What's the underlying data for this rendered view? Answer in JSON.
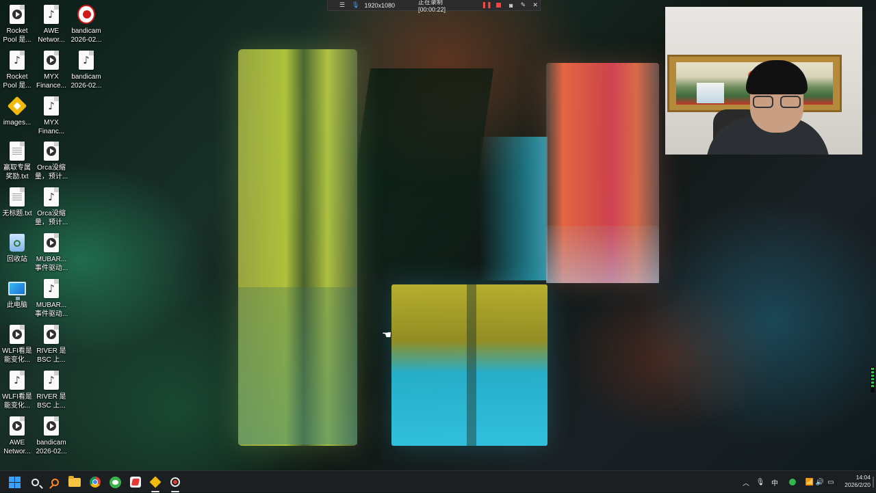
{
  "recorder_bar": {
    "resolution": "1920x1080",
    "status": "正在录制 [00:00:22]"
  },
  "desktop_icons": [
    {
      "label": "Rocket\nPool 是...",
      "icon": "video-file-icon"
    },
    {
      "label": "AWE\nNetwor...",
      "icon": "audio-file-icon"
    },
    {
      "label": "bandicam\n2026-02...",
      "icon": "bandicam-icon"
    },
    {
      "label": "Rocket\nPool 是...",
      "icon": "audio-file-icon"
    },
    {
      "label": "MYX\nFinance...",
      "icon": "video-file-icon"
    },
    {
      "label": "bandicam\n2026-02...",
      "icon": "audio-file-icon"
    },
    {
      "label": "images...",
      "icon": "binance-icon"
    },
    {
      "label": "MYX\nFinanc...",
      "icon": "audio-file-icon"
    },
    {
      "label": "赢取专属\n奖励.txt",
      "icon": "text-file-icon"
    },
    {
      "label": "Orca没缩\n量，预计...",
      "icon": "video-file-icon"
    },
    {
      "label": "无标题.txt",
      "icon": "text-file-icon"
    },
    {
      "label": "Orca没缩\n量，预计...",
      "icon": "audio-file-icon"
    },
    {
      "label": "回收站",
      "icon": "recycle-bin-icon"
    },
    {
      "label": "MUBAR...\n事件驱动...",
      "icon": "video-file-icon"
    },
    {
      "label": "此电脑",
      "icon": "this-pc-icon"
    },
    {
      "label": "MUBAR...\n事件驱动...",
      "icon": "audio-file-icon"
    },
    {
      "label": "WLFI看是\n能变化...",
      "icon": "video-file-icon"
    },
    {
      "label": "RIVER 是\nBSC 上...",
      "icon": "video-file-icon"
    },
    {
      "label": "WLFI看是\n能变化...",
      "icon": "audio-file-icon"
    },
    {
      "label": "RIVER 是\nBSC 上...",
      "icon": "audio-file-icon"
    },
    {
      "label": "AWE\nNetwor...",
      "icon": "video-file-icon"
    },
    {
      "label": "bandicam\n2026-02...",
      "icon": "video-file-icon"
    }
  ],
  "taskbar": {
    "tray_input_method": "中",
    "clock_time": "14:04",
    "clock_date": "2026/2/20"
  }
}
